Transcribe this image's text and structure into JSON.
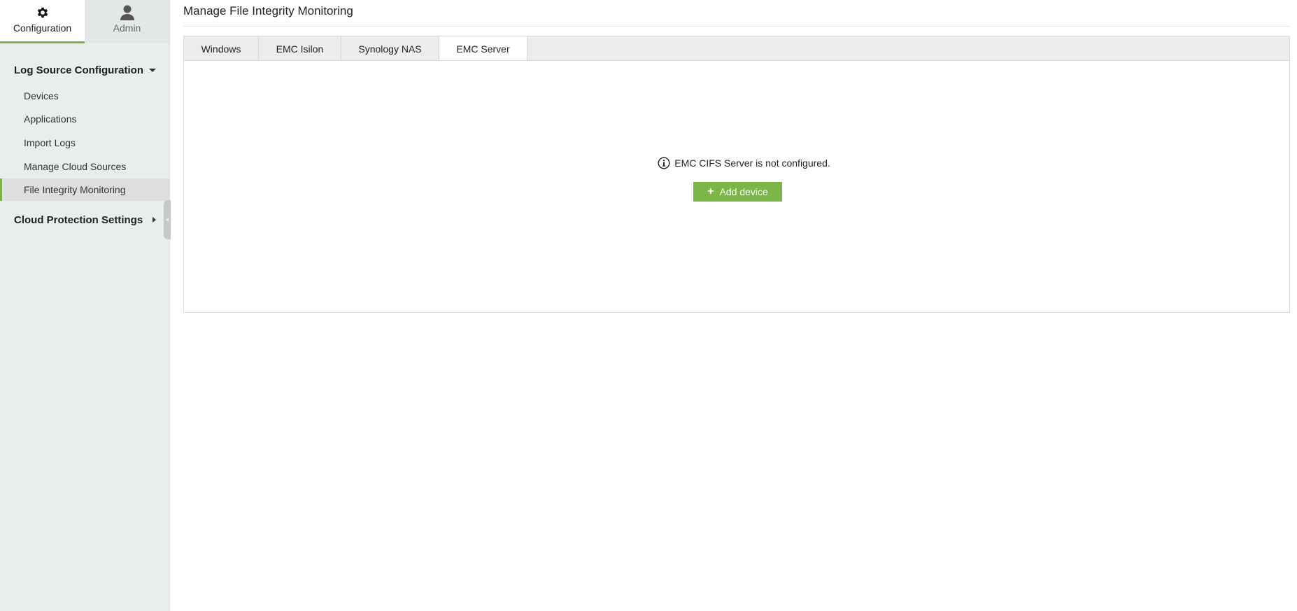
{
  "sidebar": {
    "top_tabs": [
      {
        "label": "Configuration",
        "icon": "gear-icon",
        "active": true
      },
      {
        "label": "Admin",
        "icon": "user-icon",
        "active": false
      }
    ],
    "sections": [
      {
        "title": "Log Source Configuration",
        "expanded": true,
        "items": [
          {
            "label": "Devices"
          },
          {
            "label": "Applications"
          },
          {
            "label": "Import Logs"
          },
          {
            "label": "Manage Cloud Sources"
          },
          {
            "label": "File Integrity Monitoring",
            "active": true
          }
        ]
      },
      {
        "title": "Cloud Protection Settings",
        "expanded": false
      }
    ]
  },
  "main": {
    "title": "Manage File Integrity Monitoring",
    "tabs": [
      {
        "label": "Windows"
      },
      {
        "label": "EMC Isilon"
      },
      {
        "label": "Synology NAS"
      },
      {
        "label": "EMC Server",
        "active": true
      }
    ],
    "notice": "EMC CIFS Server is not configured.",
    "add_button": "Add device"
  },
  "colors": {
    "accent": "#7ab648",
    "sidebar_bg": "#e9edec"
  }
}
